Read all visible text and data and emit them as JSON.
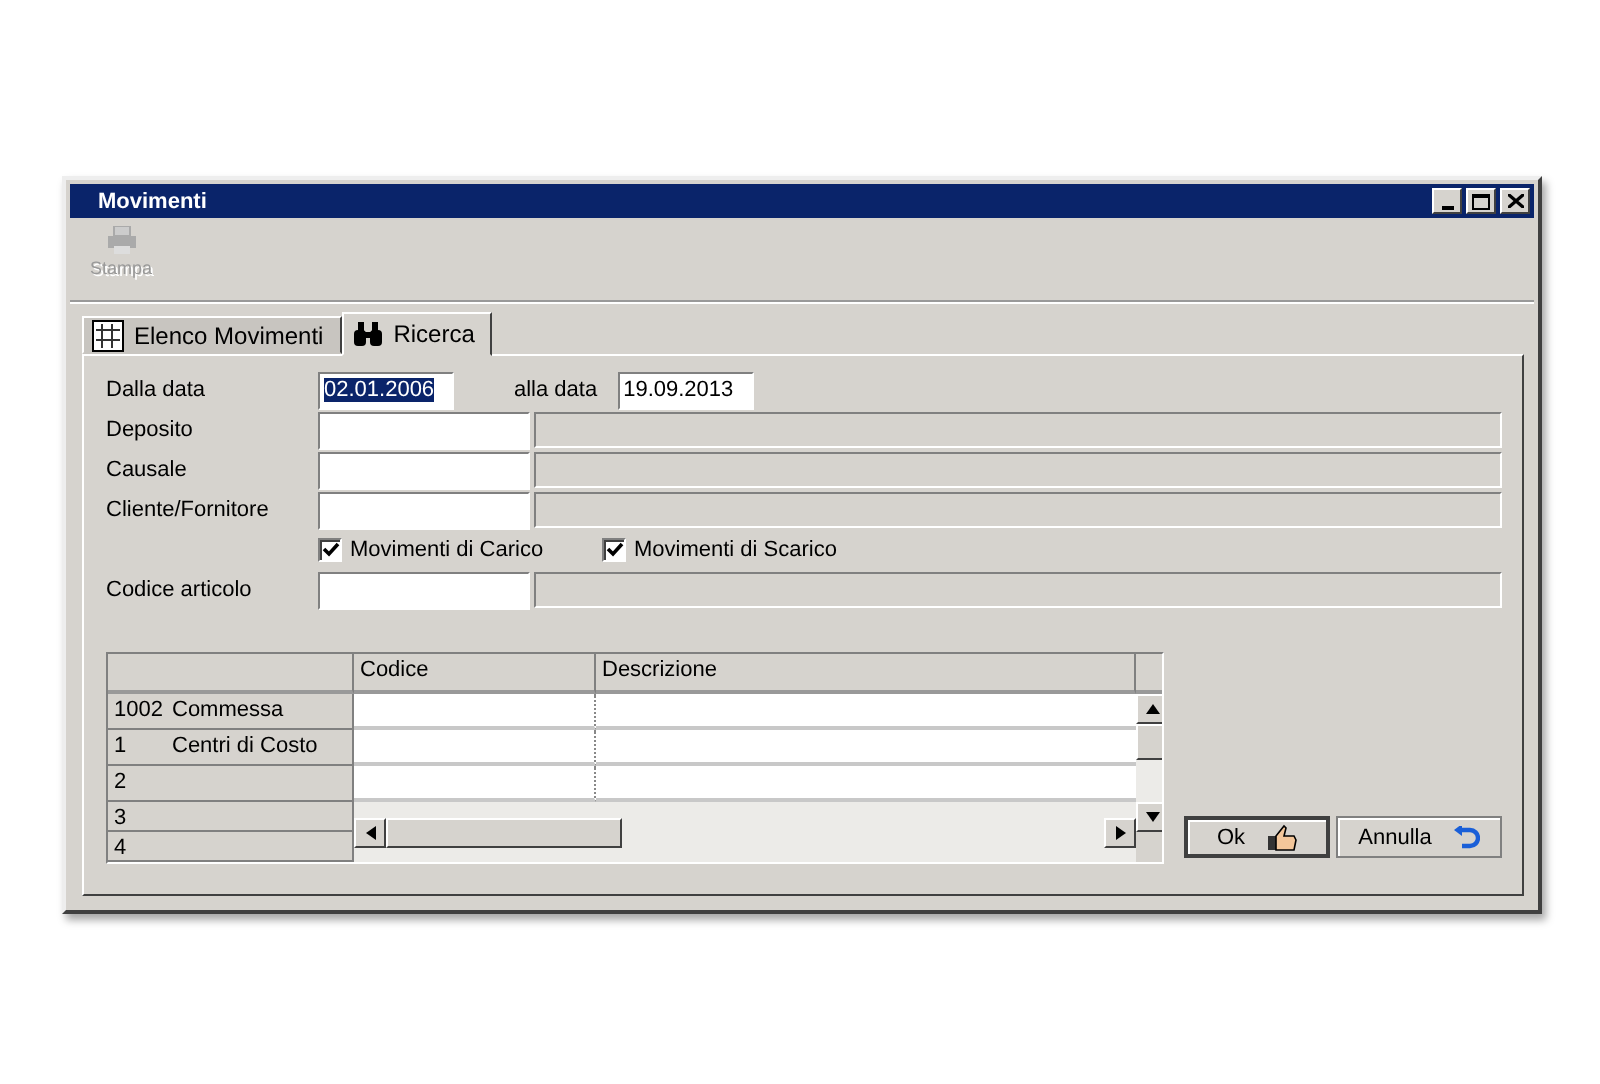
{
  "window": {
    "title": "Movimenti"
  },
  "toolbar": [
    {
      "label": "Stampa",
      "disabled": true
    }
  ],
  "tabs": [
    {
      "label": "Elenco Movimenti",
      "selected": false,
      "kind": "grid"
    },
    {
      "label": "Ricerca",
      "selected": true,
      "kind": "binoculars"
    }
  ],
  "date_from": {
    "label": "Dalla data",
    "value": "02.01.2006",
    "selected": true
  },
  "date_to": {
    "label": "alla data",
    "value": "19.09.2013",
    "selected": false
  },
  "lookups": [
    {
      "label": "Deposito"
    },
    {
      "label": "Causale"
    },
    {
      "label": "Cliente/Fornitore"
    }
  ],
  "checkboxes": [
    {
      "label": "Movimenti di Carico",
      "checked": true
    },
    {
      "label": "Movimenti di Scarico",
      "checked": true
    }
  ],
  "article": {
    "label": "Codice articolo"
  },
  "grid": {
    "columns": [
      "Codice",
      "Descrizione"
    ],
    "rows": [
      {
        "number": "1002",
        "name": "Commessa"
      },
      {
        "number": "1",
        "name": "Centri di Costo"
      },
      {
        "number": "2",
        "name": ""
      },
      {
        "number": "3",
        "name": ""
      },
      {
        "number": "4",
        "name": ""
      }
    ]
  },
  "buttons": [
    {
      "label": "Ok",
      "kind": "ok"
    },
    {
      "label": "Annulla",
      "kind": "cancel"
    }
  ]
}
